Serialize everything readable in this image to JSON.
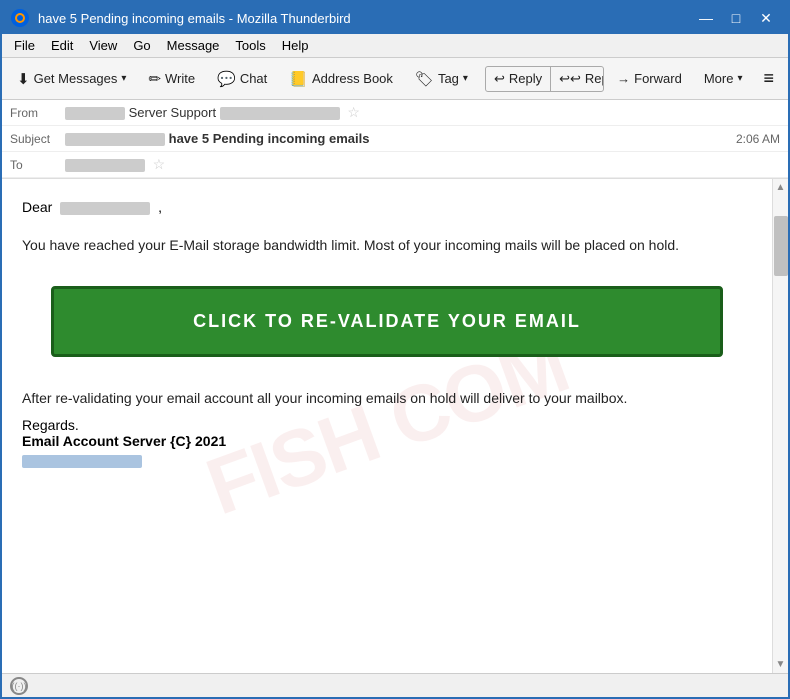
{
  "window": {
    "title": "have 5 Pending incoming emails - Mozilla Thunderbird",
    "controls": {
      "minimize": "—",
      "maximize": "□",
      "close": "✕"
    }
  },
  "menubar": {
    "items": [
      "File",
      "Edit",
      "View",
      "Go",
      "Message",
      "Tools",
      "Help"
    ]
  },
  "toolbar": {
    "get_messages": "Get Messages",
    "write": "Write",
    "chat": "Chat",
    "address_book": "Address Book",
    "tag": "Tag",
    "reply": "Reply",
    "reply_all": "Reply All",
    "forward": "Forward",
    "more": "More",
    "hamburger": "≡"
  },
  "email": {
    "from_label": "From",
    "from_value": "Server Support",
    "subject_label": "Subject",
    "subject_prefix": "have 5 Pending incoming emails",
    "time": "2:06 AM",
    "to_label": "To",
    "body": {
      "dear": "Dear",
      "comma": ",",
      "para1": "You have reached your E-Mail storage bandwidth limit.    Most of your incoming mails will be placed on hold.",
      "cta": "CLICK TO RE-VALIDATE YOUR EMAIL",
      "para2": "After re-validating your email account all your incoming emails on hold will deliver to your mailbox.",
      "regards": "Regards.",
      "signature": "Email Account Server {C} 2021"
    }
  },
  "statusbar": {
    "icon": "((·))"
  }
}
